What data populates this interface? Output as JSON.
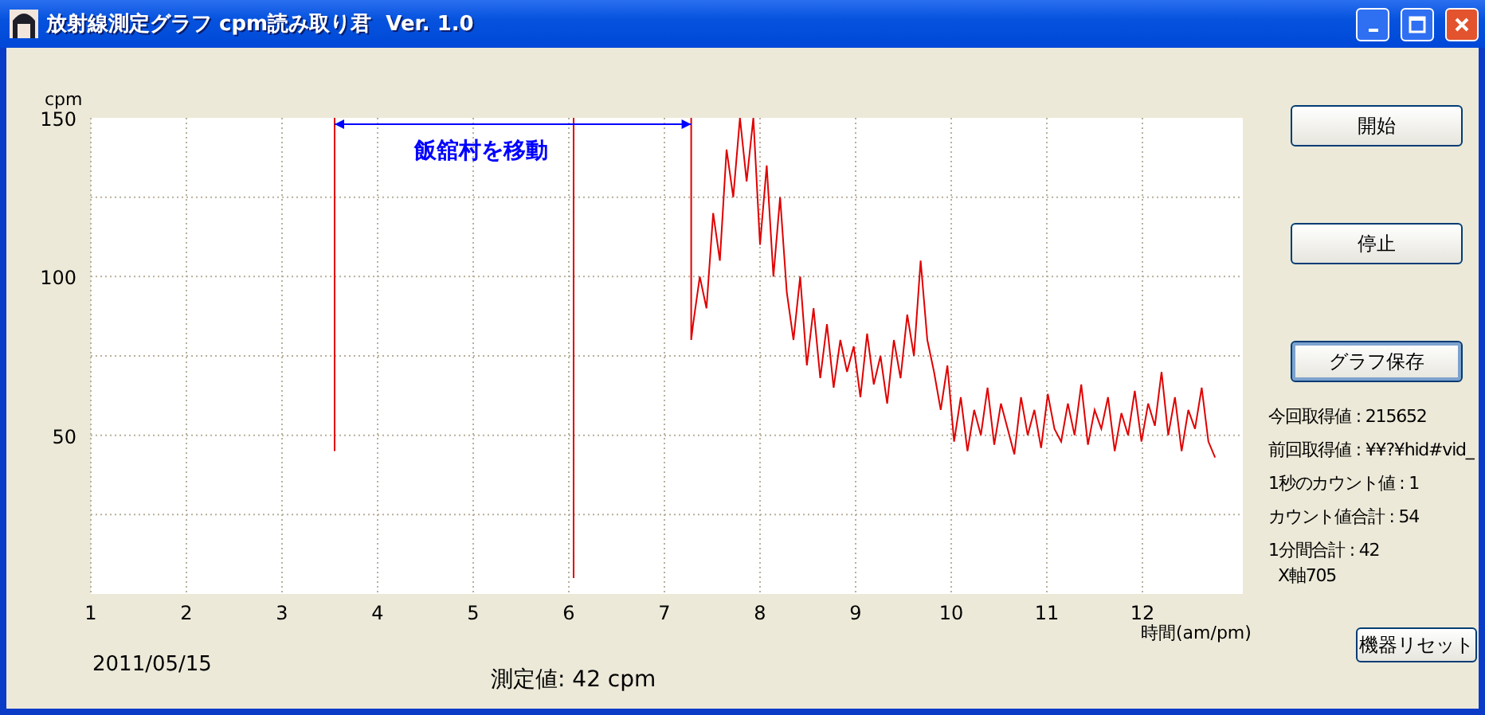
{
  "window": {
    "title": "放射線測定グラフ cpm読み取り君  Ver. 1.0"
  },
  "chart": {
    "chart_data": {
      "type": "line",
      "xlabel": "時間(am/pm)",
      "ylabel": "cpm",
      "xlim": [
        1,
        13.05
      ],
      "ylim": [
        0,
        150
      ],
      "grid": true,
      "xticks": [
        1,
        2,
        3,
        4,
        5,
        6,
        7,
        8,
        9,
        10,
        11,
        12
      ],
      "yticks": [
        50,
        100,
        150
      ],
      "x": [
        3.55,
        3.55,
        6.05,
        6.05,
        7.28,
        7.28,
        7.3,
        7.37,
        7.44,
        7.51,
        7.58,
        7.65,
        7.72,
        7.79,
        7.86,
        7.93,
        8.0,
        8.07,
        8.14,
        8.21,
        8.28,
        8.35,
        8.42,
        8.49,
        8.56,
        8.63,
        8.7,
        8.77,
        8.84,
        8.91,
        8.98,
        9.05,
        9.12,
        9.19,
        9.26,
        9.33,
        9.4,
        9.47,
        9.54,
        9.61,
        9.68,
        9.75,
        9.82,
        9.89,
        9.96,
        10.03,
        10.1,
        10.17,
        10.24,
        10.31,
        10.38,
        10.45,
        10.52,
        10.59,
        10.66,
        10.73,
        10.8,
        10.87,
        10.94,
        11.01,
        11.08,
        11.15,
        11.22,
        11.29,
        11.36,
        11.43,
        11.5,
        11.57,
        11.64,
        11.71,
        11.78,
        11.85,
        11.92,
        11.99,
        12.06,
        12.13,
        12.2,
        12.27,
        12.34,
        12.41,
        12.48,
        12.55,
        12.62,
        12.69,
        12.76
      ],
      "series": [
        {
          "color": "#e00000",
          "values": [
            150,
            45,
            150,
            5,
            150,
            80,
            85,
            100,
            90,
            120,
            105,
            140,
            125,
            150,
            130,
            150,
            110,
            135,
            100,
            125,
            95,
            80,
            100,
            72,
            90,
            68,
            85,
            65,
            80,
            70,
            78,
            62,
            82,
            66,
            75,
            60,
            80,
            68,
            88,
            75,
            105,
            80,
            70,
            58,
            72,
            48,
            62,
            45,
            58,
            50,
            65,
            47,
            60,
            52,
            44,
            62,
            50,
            58,
            46,
            63,
            52,
            48,
            60,
            50,
            66,
            47,
            58,
            52,
            62,
            45,
            57,
            50,
            64,
            48,
            60,
            53,
            70,
            50,
            62,
            45,
            58,
            52,
            65,
            48,
            43
          ]
        }
      ],
      "annotations": [
        "飯舘村を移動"
      ]
    }
  },
  "date": "2011/05/15",
  "measured": "測定値: 42 cpm",
  "buttons": [
    {
      "label": "開始",
      "focused": false
    },
    {
      "label": "停止",
      "focused": false
    },
    {
      "label": "グラフ保存",
      "focused": true
    }
  ],
  "info": [
    "今回取得値 : 215652",
    "前回取得値 : ¥¥?¥hid#vid_",
    "1秒のカウント値 : 1",
    "カウント値合計 : 54",
    "1分間合計 : 42",
    "X軸705"
  ],
  "reset_button": "機器リセット"
}
